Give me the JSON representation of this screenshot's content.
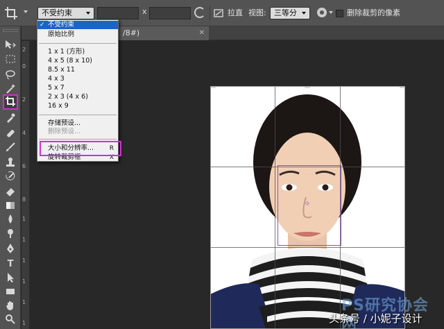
{
  "options_bar": {
    "ratio_select": "不受约束",
    "swap_symbol": "x",
    "straighten_label": "拉直",
    "view_label": "视图:",
    "view_value": "三等分",
    "delete_cropped_label": "删除裁剪的像素"
  },
  "document_tab": {
    "title": "/8#)"
  },
  "ruler_numbers": [
    "2",
    "0",
    "2",
    "4",
    "6",
    "8",
    "1",
    "1",
    "1",
    "1",
    "1",
    "1"
  ],
  "ratio_menu": {
    "items": [
      {
        "label": "不受约束",
        "checked": true,
        "selected": true
      },
      {
        "label": "原始比例"
      },
      {
        "label": "1 x 1 (方形)"
      },
      {
        "label": "4 x 5 (8 x 10)"
      },
      {
        "label": "8.5 x 11"
      },
      {
        "label": "4 x 3"
      },
      {
        "label": "5 x 7"
      },
      {
        "label": "2 x 3 (4 x 6)"
      },
      {
        "label": "16 x 9"
      },
      {
        "label": "存储预设..."
      },
      {
        "label": "删除预设...",
        "disabled": true
      },
      {
        "label": "大小和分辨率...",
        "shortcut": "R"
      },
      {
        "label": "旋转裁剪框",
        "shortcut": "X"
      }
    ]
  },
  "watermark": {
    "logo_text": "PS研究协会网",
    "credit_text": "头条号 / 小妮子设计"
  },
  "colors": {
    "highlight": "#d22fd2",
    "selection_blue": "#1c63c7",
    "crop_guide_purple": "#8a4ec6"
  }
}
